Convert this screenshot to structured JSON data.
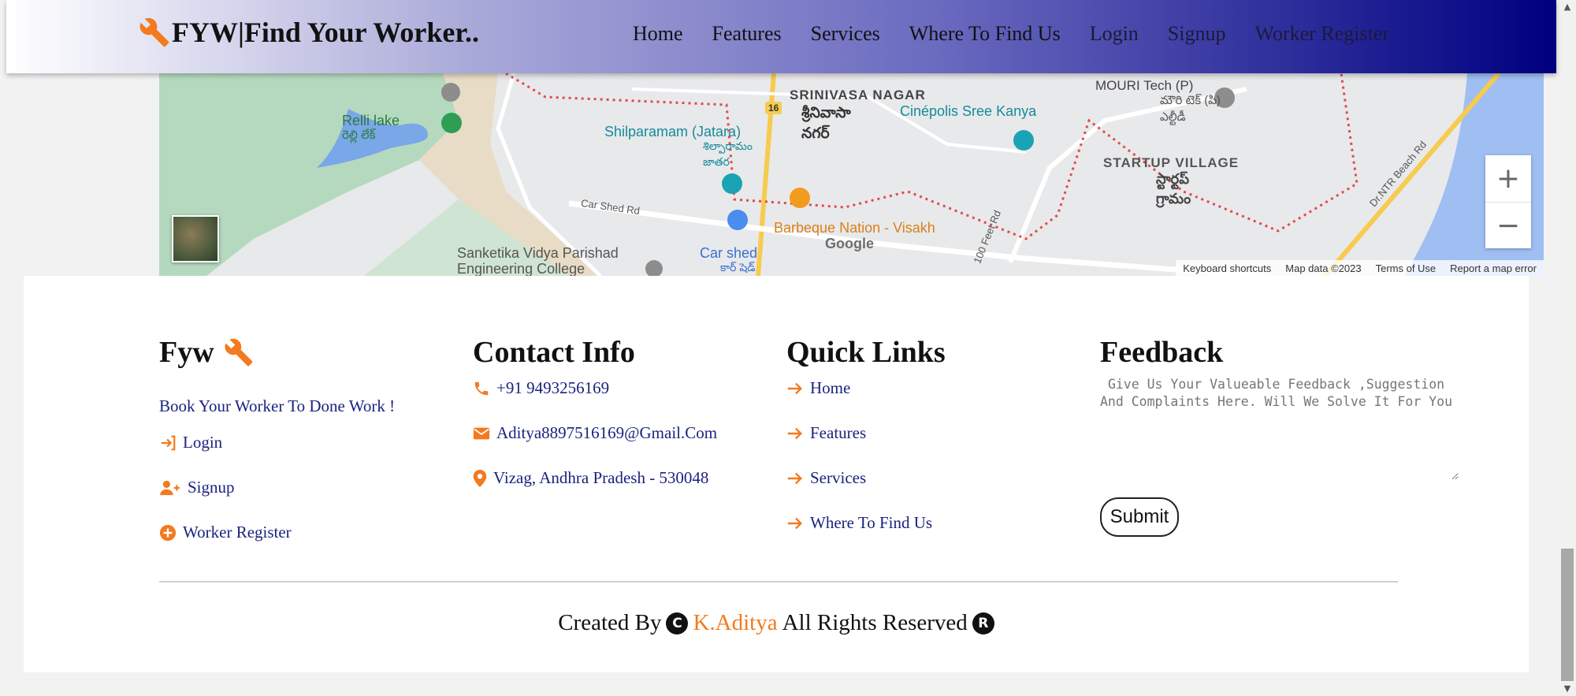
{
  "header": {
    "brand": "FYW|Find Your Worker..",
    "nav": [
      "Home",
      "Features",
      "Services",
      "Where To Find Us",
      "Login",
      "Signup",
      "Worker Register"
    ]
  },
  "map": {
    "labels": {
      "srinivasa_nagar": "SRINIVASA NAGAR",
      "srinivasa_telugu": "శ్రీనివాసా నగర్",
      "mouri": "MOURI Tech (P)",
      "mouri_telugu": "మౌరి టెక్ (పి) ఎల్టీడీ",
      "cinepolis": "Cinépolis Sree Kanya",
      "relli": "Relli lake",
      "relli_telugu": "రెల్లి లేక్",
      "shilparamam": "Shilparamam (Jatara)",
      "shilparamam_telugu": "శిల్పారామం జాతర",
      "startup": "STARTUP VILLAGE",
      "startup_telugu": "స్టార్టప్ గ్రామం",
      "carshed_road": "Car Shed Rd",
      "barbeque": "Barbeque Nation - Visakh",
      "sanketika": "Sanketika Vidya Parishad",
      "engineering": "Engineering College",
      "carshed": "Car shed",
      "carshed_telugu": "కార్ షెడ్",
      "feet_road": "100 Feet Rd",
      "beach_road": "Dr.NTR Beach Rd",
      "route": "16",
      "google": "Google"
    },
    "attribution": [
      "Keyboard shortcuts",
      "Map data ©2023",
      "Terms of Use",
      "Report a map error"
    ],
    "zoom_in": "+",
    "zoom_out": "−"
  },
  "footer": {
    "about": {
      "title": "Fyw",
      "tagline": "Book Your Worker To Done Work !",
      "links": [
        "Login",
        "Signup",
        "Worker Register"
      ]
    },
    "contact": {
      "title": "Contact Info",
      "phone": "+91 9493256169",
      "email": "Aditya8897516169@Gmail.Com",
      "address": "Vizag, Andhra Pradesh - 530048"
    },
    "quick_links": {
      "title": "Quick Links",
      "links": [
        "Home",
        "Features",
        "Services",
        "Where To Find Us"
      ]
    },
    "feedback": {
      "title": "Feedback",
      "placeholder": " Give Us Your Valueable Feedback ,Suggestion And Complaints Here. Will We Solve It For You",
      "submit": "Submit"
    },
    "credits": {
      "prefix": "Created By",
      "author": "K.Aditya",
      "suffix": "All Rights Reserved",
      "copyright_symbol": "C",
      "registered_symbol": "R"
    }
  },
  "colors": {
    "accent": "#f37a1f",
    "link": "#1a237e",
    "header_end": "#000080"
  }
}
